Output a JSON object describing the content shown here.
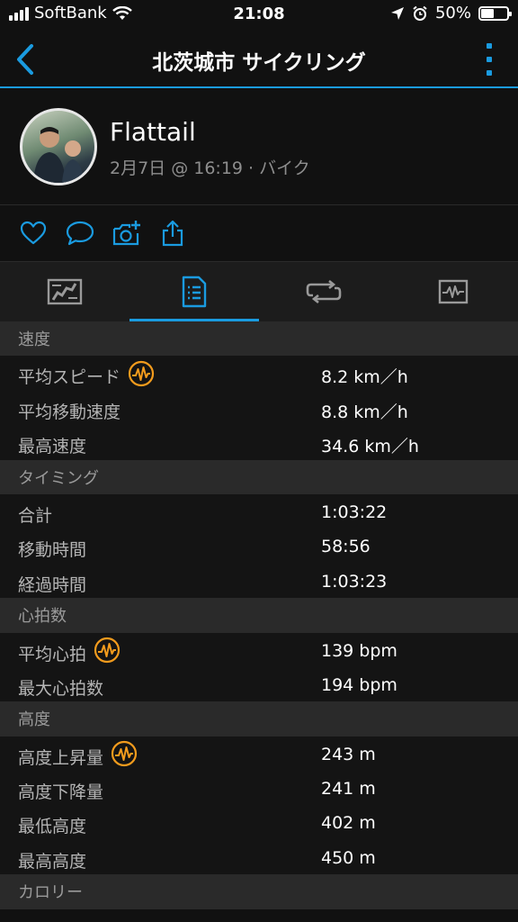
{
  "status_bar": {
    "carrier": "SoftBank",
    "time": "21:08",
    "battery": "50%"
  },
  "nav": {
    "title": "北茨城市 サイクリング"
  },
  "profile": {
    "name": "Flattail",
    "meta": "2月7日 @ 16:19 · バイク"
  },
  "colors": {
    "accent": "#1a9be0",
    "badge": "#f29b1d",
    "section_bg": "#2a2a2a",
    "row_bg": "#141414"
  },
  "icons": {
    "social": [
      "heart-icon",
      "comment-icon",
      "camera-add-icon",
      "share-icon"
    ],
    "tabs": [
      "map-icon",
      "stats-list-icon",
      "laps-icon",
      "chart-icon"
    ]
  },
  "stats": {
    "sections": [
      {
        "title": "速度",
        "rows": [
          {
            "label": "平均スピード",
            "value": "8.2 km／h",
            "badge": true
          },
          {
            "label": "平均移動速度",
            "value": "8.8 km／h",
            "badge": false
          },
          {
            "label": "最高速度",
            "value": "34.6 km／h",
            "badge": false
          }
        ]
      },
      {
        "title": "タイミング",
        "rows": [
          {
            "label": "合計",
            "value": "1:03:22",
            "badge": false
          },
          {
            "label": "移動時間",
            "value": "58:56",
            "badge": false
          },
          {
            "label": "経過時間",
            "value": "1:03:23",
            "badge": false
          }
        ]
      },
      {
        "title": "心拍数",
        "rows": [
          {
            "label": "平均心拍",
            "value": "139 bpm",
            "badge": true
          },
          {
            "label": "最大心拍数",
            "value": "194 bpm",
            "badge": false
          }
        ]
      },
      {
        "title": "高度",
        "rows": [
          {
            "label": "高度上昇量",
            "value": "243 m",
            "badge": true
          },
          {
            "label": "高度下降量",
            "value": "241 m",
            "badge": false
          },
          {
            "label": "最低高度",
            "value": "402 m",
            "badge": false
          },
          {
            "label": "最高高度",
            "value": "450 m",
            "badge": false
          }
        ]
      },
      {
        "title": "カロリー",
        "rows": []
      }
    ]
  }
}
